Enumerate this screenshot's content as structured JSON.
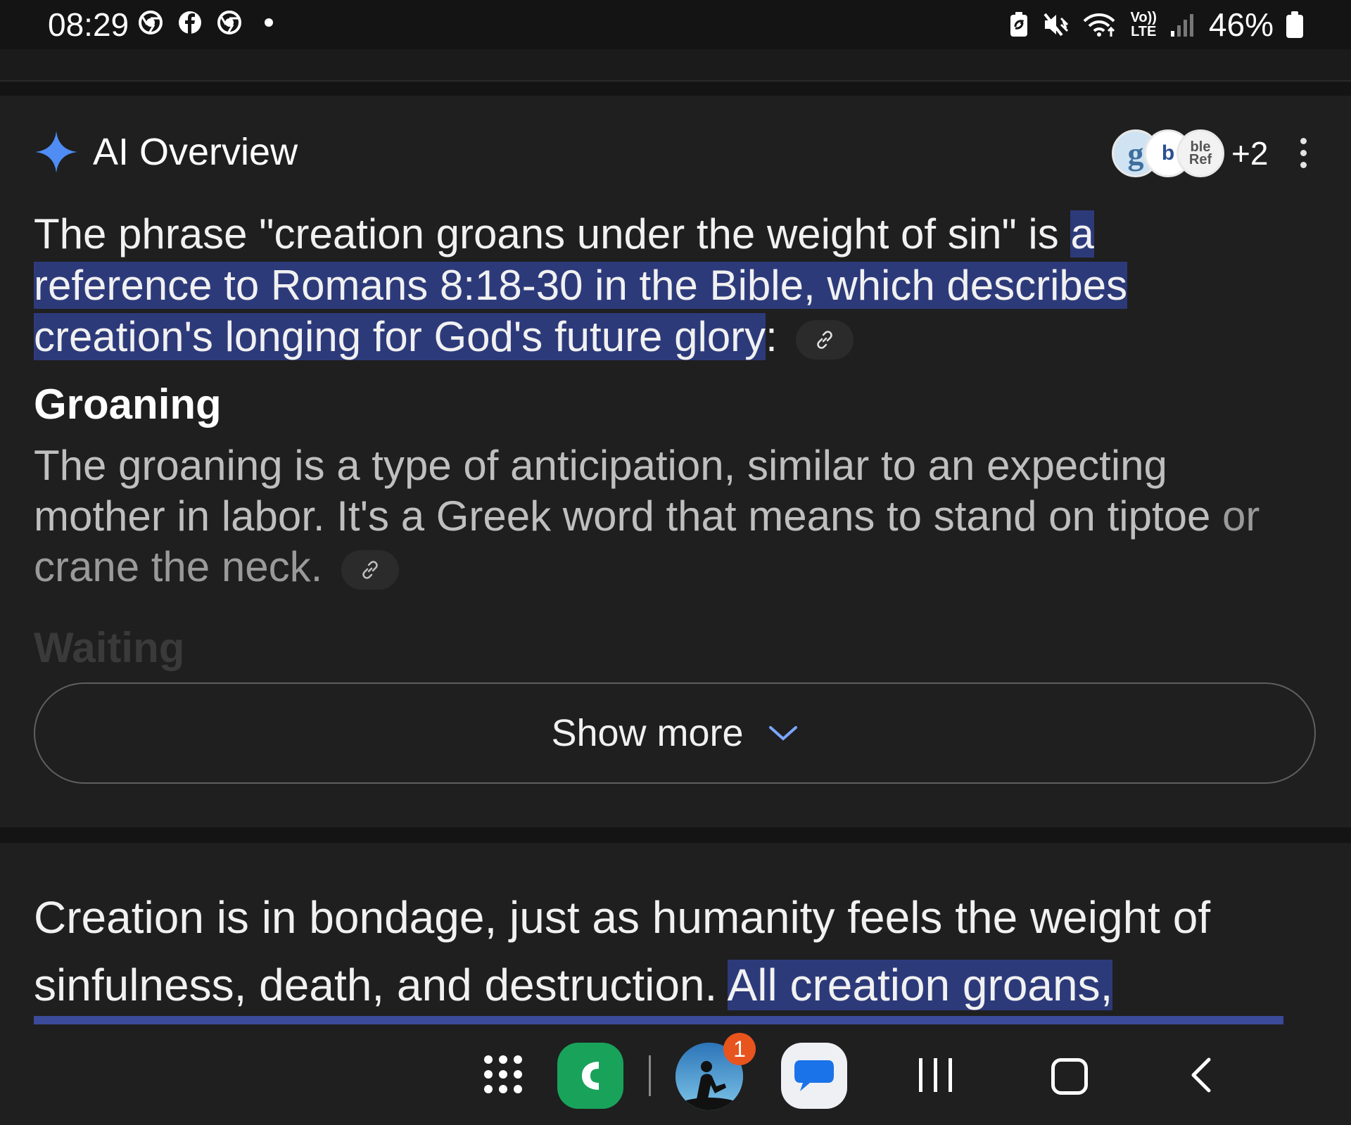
{
  "status_bar": {
    "time": "08:29",
    "left_icons": [
      "chrome-icon",
      "facebook-icon",
      "chrome-icon",
      "notification-dot"
    ],
    "right_icons": [
      "battery-saver-icon",
      "mute-icon",
      "wifi-icon",
      "volte-lte-icon",
      "signal-icon"
    ],
    "volte_label": "Vo))",
    "lte_label": "LTE",
    "battery": "46%"
  },
  "ai_overview": {
    "title": "AI Overview",
    "sources_more": "+2",
    "source_avatars": [
      "g",
      "b",
      "ble Ref"
    ],
    "para1_plain": "The phrase \"creation groans under the weight of sin\" is ",
    "para1_highlight": "a reference to Romans 8:18-30 in the Bible, which describes creation's longing for God's future glory",
    "para1_end": ":",
    "heading_groaning": "Groaning",
    "para2_main": "The groaning is a type of anticipation, similar to an expecting mother in labor. It's a Greek word that means to stand on tiptoe ",
    "para2_fade": "or crane the neck.",
    "heading_waiting": "Waiting",
    "show_more": "Show more"
  },
  "result": {
    "text_plain": "Creation is in bondage, just as humanity feels the weight of sinfulness, death, and destruction. ",
    "text_highlight": "All creation groans,"
  },
  "nav_bar": {
    "badge_count": "1",
    "apps": [
      "apps-grid-icon",
      "phone-app-icon",
      "kindle-app-icon",
      "messages-app-icon"
    ]
  },
  "colors": {
    "background": "#1f1f1f",
    "highlight": "#2d3a7a",
    "gemini_spark": "#4f8df5",
    "phone_green": "#19a25a",
    "badge_orange": "#e8541e"
  }
}
